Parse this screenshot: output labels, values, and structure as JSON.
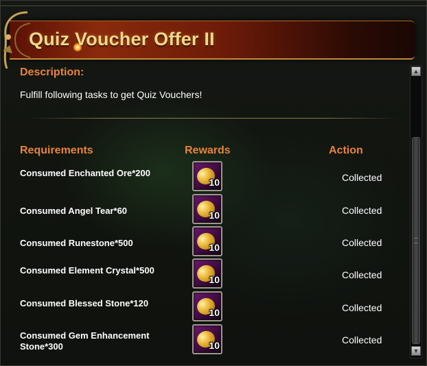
{
  "window": {
    "title": "Quiz Voucher Offer II"
  },
  "description": {
    "label": "Description:",
    "text": "Fulfill following tasks to get Quiz Vouchers!"
  },
  "columns": {
    "requirements": "Requirements",
    "rewards": "Rewards",
    "action": "Action"
  },
  "tasks": [
    {
      "requirement": "Consumed Enchanted Ore*200",
      "reward_icon": "quiz-voucher-icon",
      "reward_count": "10",
      "action": "Collected"
    },
    {
      "requirement": "Consumed Angel Tear*60",
      "reward_icon": "quiz-voucher-icon",
      "reward_count": "10",
      "action": "Collected"
    },
    {
      "requirement": "Consumed Runestone*500",
      "reward_icon": "quiz-voucher-icon",
      "reward_count": "10",
      "action": "Collected"
    },
    {
      "requirement": "Consumed Element Crystal*500",
      "reward_icon": "quiz-voucher-icon",
      "reward_count": "10",
      "action": "Collected"
    },
    {
      "requirement": "Consumed Blessed Stone*120",
      "reward_icon": "quiz-voucher-icon",
      "reward_count": "10",
      "action": "Collected"
    },
    {
      "requirement": "Consumed Gem Enhancement Stone*300",
      "reward_icon": "quiz-voucher-icon",
      "reward_count": "10",
      "action": "Collected"
    }
  ],
  "colors": {
    "accent_orange": "#e8843a",
    "title_gold": "#f2d98a",
    "banner_red": "#8a2a0c",
    "reward_purple": "#6a1a6a"
  }
}
